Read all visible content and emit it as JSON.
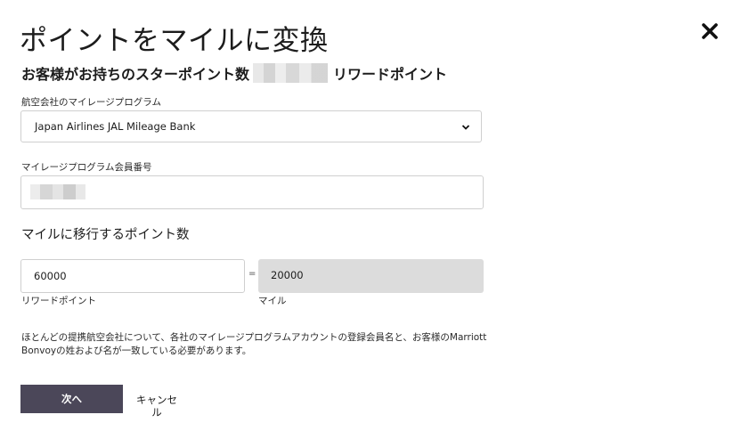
{
  "header": {
    "title": "ポイントをマイルに変換",
    "close_icon": "close-icon"
  },
  "balance": {
    "prefix": "お客様がお持ちのスターポイント数",
    "suffix": "リワードポイント"
  },
  "airline": {
    "label": "航空会社のマイレージプログラム",
    "selected": "Japan Airlines JAL Mileage Bank",
    "chevron_icon": "chevron-down-icon"
  },
  "member": {
    "label": "マイレージプログラム会員番号"
  },
  "transfer": {
    "heading": "マイルに移行するポイント数",
    "points_value": "60000",
    "points_unit": "リワードポイント",
    "equals": "=",
    "miles_value": "20000",
    "miles_unit": "マイル"
  },
  "notice": {
    "text": "ほとんどの提携航空会社について、各社のマイレージプログラムアカウントの登録会員名と、お客様のMarriott Bonvoyの姓および名が一致している必要があります。"
  },
  "actions": {
    "next_label": "次へ",
    "cancel_label": "キャンセル"
  },
  "colors": {
    "primary_button": "#4b4759",
    "readonly_field": "#dcdcdc",
    "border": "#cfcfcf"
  }
}
